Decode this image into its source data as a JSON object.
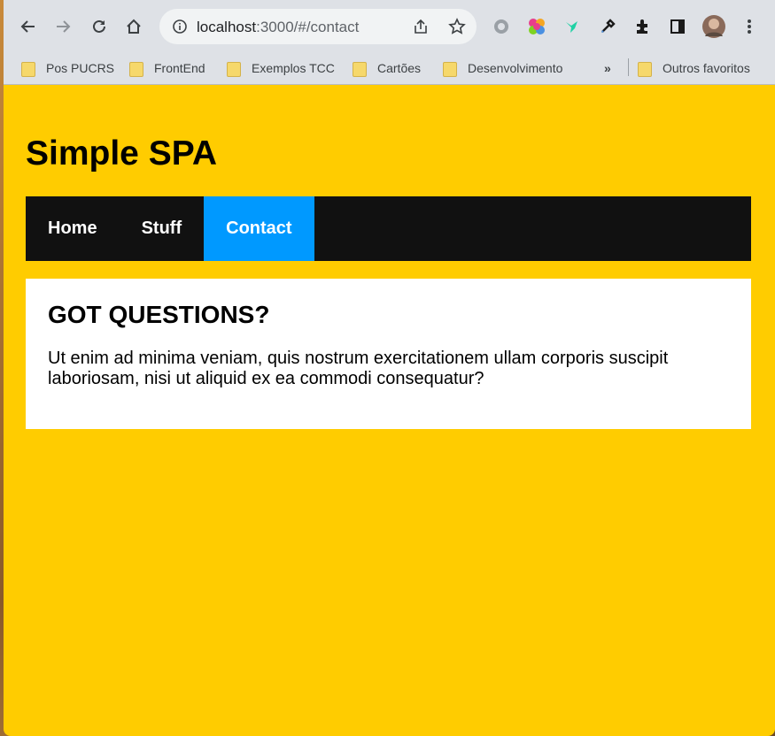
{
  "browser": {
    "url_host": "localhost",
    "url_path": ":3000/#/contact",
    "bookmarks": [
      "Pos PUCRS",
      "FrontEnd",
      "Exemplos TCC",
      "Cartões",
      "Desenvolvimento"
    ],
    "overflow_label": "»",
    "other_bookmarks": "Outros favoritos"
  },
  "page": {
    "title": "Simple SPA",
    "nav": [
      {
        "label": "Home",
        "active": false
      },
      {
        "label": "Stuff",
        "active": false
      },
      {
        "label": "Contact",
        "active": true
      }
    ],
    "content": {
      "heading": "GOT QUESTIONS?",
      "text": "Ut enim ad minima veniam, quis nostrum exercitationem ullam corporis suscipit laboriosam, nisi ut aliquid ex ea commodi consequatur?"
    }
  },
  "colors": {
    "page_bg": "#ffcc00",
    "nav_bg": "#111111",
    "nav_active": "#0099ff"
  }
}
